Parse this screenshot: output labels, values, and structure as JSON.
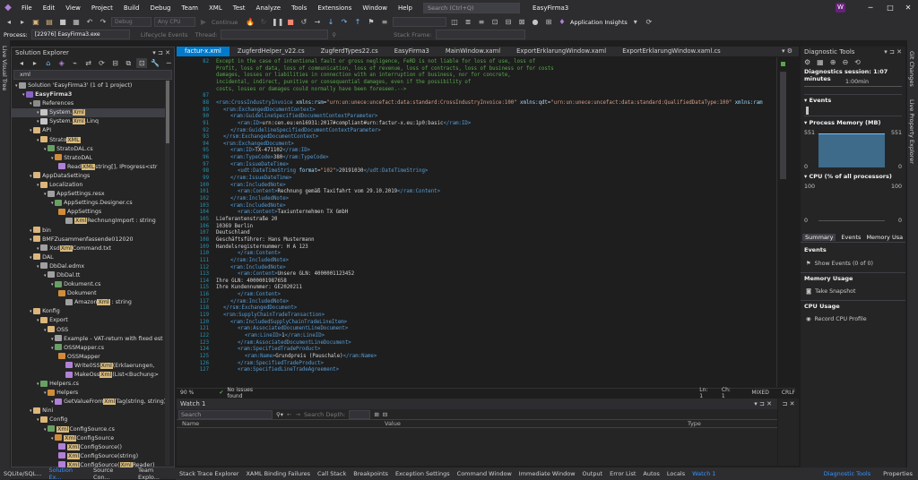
{
  "menubar": {
    "items": [
      "File",
      "Edit",
      "View",
      "Project",
      "Build",
      "Debug",
      "Team",
      "XML",
      "Test",
      "Analyze",
      "Tools",
      "Extensions",
      "Window",
      "Help"
    ],
    "search_placeholder": "Search (Ctrl+Q)",
    "title": "EasyFirma3",
    "avatar": "W"
  },
  "toolbar": {
    "config": "Debug",
    "platform": "Any CPU",
    "continue": "Continue",
    "insights": "Application Insights"
  },
  "process_bar": {
    "label": "Process:",
    "process": "[22976] EasyFirma3.exe",
    "lifecycle": "Lifecycle Events",
    "thread": "Thread:",
    "stack": "Stack Frame:"
  },
  "left_strip": {
    "label": "Live Visual Tree"
  },
  "solution_explorer": {
    "title": "Solution Explorer",
    "search_value": "xml",
    "nodes": [
      {
        "d": 0,
        "t": "Solution 'EasyFirma3' (1 of 1 project)",
        "c": "#9b9b9b"
      },
      {
        "d": 1,
        "t": "EasyFirma3",
        "c": "#8a62c4",
        "b": true
      },
      {
        "d": 2,
        "t": "References",
        "c": "#8a8a8a"
      },
      {
        "d": 3,
        "p": "System.",
        "h": "Xml",
        "s": "",
        "c": "#c5c5c5",
        "sel": true
      },
      {
        "d": 3,
        "p": "System.",
        "h": "Xml",
        "s": ".Linq",
        "c": "#c5c5c5"
      },
      {
        "d": 2,
        "t": "API",
        "c": "#dcb67a"
      },
      {
        "d": 3,
        "p": "Strato",
        "h": "XML",
        "s": "",
        "c": "#dcb67a"
      },
      {
        "d": 4,
        "t": "StratoDAL.cs",
        "c": "#68a063"
      },
      {
        "d": 5,
        "t": "StratoDAL",
        "c": "#d18c3a"
      },
      {
        "d": 6,
        "p": "Read",
        "h": "XML",
        "s": "string[], IProgress<str",
        "c": "#b180d7"
      },
      {
        "d": 2,
        "t": "AppDataSettings",
        "c": "#dcb67a"
      },
      {
        "d": 3,
        "t": "Localization",
        "c": "#dcb67a"
      },
      {
        "d": 4,
        "t": "AppSettings.resx",
        "c": "#a0a0a0"
      },
      {
        "d": 5,
        "t": "AppSettings.Designer.cs",
        "c": "#68a063"
      },
      {
        "d": 6,
        "t": "AppSettings",
        "c": "#d18c3a"
      },
      {
        "d": 7,
        "p": "",
        "h": "Xml",
        "s": "RechnungImport : string",
        "c": "#a0a0a0"
      },
      {
        "d": 2,
        "t": "bin",
        "c": "#dcb67a"
      },
      {
        "d": 2,
        "t": "BMFZusammenfassende012020",
        "c": "#dcb67a"
      },
      {
        "d": 3,
        "p": "Xsd",
        "h": "Xml",
        "s": "Command.txt",
        "c": "#a0a0a0"
      },
      {
        "d": 2,
        "t": "DAL",
        "c": "#dcb67a"
      },
      {
        "d": 3,
        "t": "DbDal.edmx",
        "c": "#a0a0a0"
      },
      {
        "d": 4,
        "t": "DbDal.tt",
        "c": "#a0a0a0"
      },
      {
        "d": 5,
        "t": "Dokument.cs",
        "c": "#68a063"
      },
      {
        "d": 6,
        "t": "Dokument",
        "c": "#d18c3a"
      },
      {
        "d": 7,
        "p": "Amazon",
        "h": "Xml",
        "s": " : string",
        "c": "#a0a0a0"
      },
      {
        "d": 2,
        "t": "Konfig",
        "c": "#dcb67a"
      },
      {
        "d": 3,
        "t": "Export",
        "c": "#dcb67a"
      },
      {
        "d": 4,
        "t": "OSS",
        "c": "#dcb67a"
      },
      {
        "d": 5,
        "t": "Example - VAT-return with fixed est",
        "c": "#a0a0a0"
      },
      {
        "d": 5,
        "t": "OSSMapper.cs",
        "c": "#68a063"
      },
      {
        "d": 6,
        "t": "OSSMapper",
        "c": "#d18c3a"
      },
      {
        "d": 7,
        "p": "Write0SS",
        "h": "Xml",
        "s": "(Erklaerungen,",
        "c": "#b180d7"
      },
      {
        "d": 7,
        "p": "MakeOss",
        "h": "Xml",
        "s": "(List<Buchung>",
        "c": "#b180d7"
      },
      {
        "d": 3,
        "t": "Helpers.cs",
        "c": "#68a063"
      },
      {
        "d": 4,
        "t": "Helpers",
        "c": "#d18c3a"
      },
      {
        "d": 5,
        "p": "GetValueFrom",
        "h": "Xml",
        "s": "Tag(string, string)",
        "c": "#b180d7"
      },
      {
        "d": 2,
        "t": "Nini",
        "c": "#dcb67a"
      },
      {
        "d": 3,
        "t": "Config",
        "c": "#dcb67a"
      },
      {
        "d": 4,
        "p": "",
        "h": "Xml",
        "s": "ConfigSource.cs",
        "c": "#68a063"
      },
      {
        "d": 5,
        "p": "",
        "h": "Xml",
        "s": "ConfigSource",
        "c": "#d18c3a"
      },
      {
        "d": 6,
        "p": "",
        "h": "Xml",
        "s": "ConfigSource()",
        "c": "#b180d7"
      },
      {
        "d": 6,
        "p": "",
        "h": "Xml",
        "s": "ConfigSource(string)",
        "c": "#b180d7"
      },
      {
        "d": 6,
        "p": "",
        "h": "Xml",
        "s": "ConfigSource(",
        "h2": "Xml",
        "s2": "Reader)",
        "c": "#b180d7"
      },
      {
        "d": 2,
        "t": "obj",
        "c": "#dcb67a"
      }
    ]
  },
  "bottom_left_tabs": [
    "SQLite/SQL...",
    "Solution Ex...",
    "Source Con...",
    "Team Explo..."
  ],
  "doc_tabs": [
    "factur-x.xml",
    "ZugferdHelper_v22.cs",
    "ZugferdTypes22.cs",
    "EasyFirma3",
    "MainWindow.xaml",
    "ExportErklarungWindow.xaml",
    "ExportErklarungWindow.xaml.cs"
  ],
  "code_lines": [
    {
      "n": "82",
      "i": 0,
      "parts": [
        [
          "cmt",
          "Except in the case of intentional fault or gross negligence, FeRD is not liable for loss of use, loss of"
        ]
      ]
    },
    {
      "n": "",
      "i": 0,
      "parts": [
        [
          "cmt",
          "Profit, loss of data, loss of communication, loss of revenue, loss of contracts, loss of business or for costs"
        ]
      ]
    },
    {
      "n": "",
      "i": 0,
      "parts": [
        [
          "cmt",
          "damages, losses or liabilities in connection with an interruption of business, nor for concrete,"
        ]
      ]
    },
    {
      "n": "",
      "i": 0,
      "parts": [
        [
          "cmt",
          "incidental, indirect, punitive or consequential damages, even if the possibility of"
        ]
      ]
    },
    {
      "n": "",
      "i": 0,
      "parts": [
        [
          "cmt",
          "costs, losses or damages could normally have been foreseen.-->"
        ]
      ]
    },
    {
      "n": "87",
      "i": 0,
      "parts": []
    },
    {
      "n": "88",
      "i": 0,
      "parts": [
        [
          "tag",
          "<rsm:CrossIndustryInvoice "
        ],
        [
          "att",
          "xmlns:rsm"
        ],
        [
          "",
          "="
        ],
        [
          "str",
          "\"urn:un:unece:uncefact:data:standard:CrossIndustryInvoice:100\""
        ],
        [
          "att",
          " xmlns:qdt"
        ],
        [
          "",
          "="
        ],
        [
          "str",
          "\"urn:un:unece:uncefact:data:standard:QualifiedDataType:100\""
        ],
        [
          "att",
          " xmlns:ram"
        ]
      ]
    },
    {
      "n": "89",
      "i": 1,
      "parts": [
        [
          "tag",
          "<rsm:ExchangedDocumentContext>"
        ]
      ]
    },
    {
      "n": "90",
      "i": 2,
      "parts": [
        [
          "tag",
          "<ram:GuidelineSpecifiedDocumentContextParameter>"
        ]
      ]
    },
    {
      "n": "91",
      "i": 3,
      "parts": [
        [
          "tag",
          "<ram:ID>"
        ],
        [
          "",
          "urn:cen.eu:en16931:2017#compliant#urn:factur-x.eu:1p0:basic"
        ],
        [
          "tag",
          "</ram:ID>"
        ]
      ]
    },
    {
      "n": "92",
      "i": 2,
      "parts": [
        [
          "tag",
          "</ram:GuidelineSpecifiedDocumentContextParameter>"
        ]
      ]
    },
    {
      "n": "93",
      "i": 1,
      "parts": [
        [
          "tag",
          "</rsm:ExchangedDocumentContext>"
        ]
      ]
    },
    {
      "n": "94",
      "i": 1,
      "parts": [
        [
          "tag",
          "<rsm:ExchangedDocument>"
        ]
      ]
    },
    {
      "n": "95",
      "i": 2,
      "parts": [
        [
          "tag",
          "<ram:ID>"
        ],
        [
          "",
          "TX-471102"
        ],
        [
          "tag",
          "</ram:ID>"
        ]
      ]
    },
    {
      "n": "96",
      "i": 2,
      "parts": [
        [
          "tag",
          "<ram:TypeCode>"
        ],
        [
          "",
          "380"
        ],
        [
          "tag",
          "</ram:TypeCode>"
        ]
      ]
    },
    {
      "n": "97",
      "i": 2,
      "parts": [
        [
          "tag",
          "<ram:IssueDateTime>"
        ]
      ]
    },
    {
      "n": "98",
      "i": 3,
      "parts": [
        [
          "tag",
          "<udt:DateTimeString "
        ],
        [
          "att",
          "format"
        ],
        [
          "",
          "="
        ],
        [
          "str",
          "\"102\""
        ],
        [
          "tag",
          ">"
        ],
        [
          "",
          "20191030"
        ],
        [
          "tag",
          "</udt:DateTimeString>"
        ]
      ]
    },
    {
      "n": "99",
      "i": 2,
      "parts": [
        [
          "tag",
          "</ram:IssueDateTime>"
        ]
      ]
    },
    {
      "n": "100",
      "i": 2,
      "parts": [
        [
          "tag",
          "<ram:IncludedNote>"
        ]
      ]
    },
    {
      "n": "101",
      "i": 3,
      "parts": [
        [
          "tag",
          "<ram:Content>"
        ],
        [
          "",
          "Rechnung gemäß Taxifahrt vom 29.10.2019"
        ],
        [
          "tag",
          "</ram:Content>"
        ]
      ]
    },
    {
      "n": "102",
      "i": 2,
      "parts": [
        [
          "tag",
          "</ram:IncludedNote>"
        ]
      ]
    },
    {
      "n": "103",
      "i": 2,
      "parts": [
        [
          "tag",
          "<ram:IncludedNote>"
        ]
      ]
    },
    {
      "n": "104",
      "i": 3,
      "parts": [
        [
          "tag",
          "<ram:Content>"
        ],
        [
          "",
          "Taxiunternehmen TX GmbH"
        ]
      ]
    },
    {
      "n": "105",
      "i": 0,
      "parts": [
        [
          "",
          "Lieferantenstraße 20"
        ]
      ]
    },
    {
      "n": "106",
      "i": 0,
      "parts": [
        [
          "",
          "10369 Berlin"
        ]
      ]
    },
    {
      "n": "107",
      "i": 0,
      "parts": [
        [
          "",
          "Deutschland"
        ]
      ]
    },
    {
      "n": "108",
      "i": 0,
      "parts": [
        [
          "",
          "Geschäftsführer: Hans Mustermann"
        ]
      ]
    },
    {
      "n": "109",
      "i": 0,
      "parts": [
        [
          "",
          "Handelsregisternummer: H A 123"
        ]
      ]
    },
    {
      "n": "110",
      "i": 3,
      "parts": [
        [
          "tag",
          "</ram:Content>"
        ]
      ]
    },
    {
      "n": "111",
      "i": 2,
      "parts": [
        [
          "tag",
          "</ram:IncludedNote>"
        ]
      ]
    },
    {
      "n": "112",
      "i": 2,
      "parts": [
        [
          "tag",
          "<ram:IncludedNote>"
        ]
      ]
    },
    {
      "n": "113",
      "i": 3,
      "parts": [
        [
          "tag",
          "<ram:Content>"
        ],
        [
          "",
          "Unsere GLN: 4000001123452"
        ]
      ]
    },
    {
      "n": "114",
      "i": 0,
      "parts": [
        [
          "",
          "Ihre GLN: 4000001987658"
        ]
      ]
    },
    {
      "n": "115",
      "i": 0,
      "parts": [
        [
          "",
          "Ihre Kundennummer: GE2020211"
        ]
      ]
    },
    {
      "n": "116",
      "i": 3,
      "parts": [
        [
          "tag",
          "</ram:Content>"
        ]
      ]
    },
    {
      "n": "117",
      "i": 2,
      "parts": [
        [
          "tag",
          "</ram:IncludedNote>"
        ]
      ]
    },
    {
      "n": "118",
      "i": 1,
      "parts": [
        [
          "tag",
          "</rsm:ExchangedDocument>"
        ]
      ]
    },
    {
      "n": "119",
      "i": 1,
      "parts": [
        [
          "tag",
          "<rsm:SupplyChainTradeTransaction>"
        ]
      ]
    },
    {
      "n": "120",
      "i": 2,
      "parts": [
        [
          "tag",
          "<ram:IncludedSupplyChainTradeLineItem>"
        ]
      ]
    },
    {
      "n": "121",
      "i": 3,
      "parts": [
        [
          "tag",
          "<ram:AssociatedDocumentLineDocument>"
        ]
      ]
    },
    {
      "n": "122",
      "i": 4,
      "parts": [
        [
          "tag",
          "<ram:LineID>"
        ],
        [
          "",
          "1"
        ],
        [
          "tag",
          "</ram:LineID>"
        ]
      ]
    },
    {
      "n": "123",
      "i": 3,
      "parts": [
        [
          "tag",
          "</ram:AssociatedDocumentLineDocument>"
        ]
      ]
    },
    {
      "n": "124",
      "i": 3,
      "parts": [
        [
          "tag",
          "<ram:SpecifiedTradeProduct>"
        ]
      ]
    },
    {
      "n": "125",
      "i": 4,
      "parts": [
        [
          "tag",
          "<ram:Name>"
        ],
        [
          "",
          "Grundpreis (Pauschale)"
        ],
        [
          "tag",
          "</ram:Name>"
        ]
      ]
    },
    {
      "n": "126",
      "i": 3,
      "parts": [
        [
          "tag",
          "</ram:SpecifiedTradeProduct>"
        ]
      ]
    },
    {
      "n": "127",
      "i": 3,
      "parts": [
        [
          "tag",
          "<ram:SpecifiedLineTradeAgreement>"
        ]
      ]
    }
  ],
  "editor_status": {
    "zoom": "90 %",
    "issues": "No issues found",
    "line": "Ln: 1",
    "col": "Ch: 1",
    "mode": "MIXED",
    "eol": "CRLF"
  },
  "watch": {
    "title": "Watch 1",
    "search_placeholder": "Search",
    "search_depth": "Search Depth:",
    "columns": [
      "Name",
      "Value",
      "Type"
    ]
  },
  "diagnostics": {
    "title": "Diagnostic Tools",
    "session": "Diagnostics session: 1:07 minutes",
    "timeline": "1:00min",
    "events_header": "Events",
    "memory_header": "Process Memory (MB)",
    "mem_max": "551",
    "mem_min": "0",
    "cpu_header": "CPU (% of all processors)",
    "cpu_max": "100",
    "cpu_min": "0",
    "tabs": [
      "Summary",
      "Events",
      "Memory Usa"
    ],
    "events_section": "Events",
    "show_events": "Show Events (0 of 0)",
    "memory_section": "Memory Usage",
    "snapshot": "Take Snapshot",
    "cpu_section": "CPU Usage",
    "record": "Record CPU Profile"
  },
  "right_strip": [
    "Git Changes",
    "Live Property Explorer"
  ],
  "bottom_tabs": [
    "Stack Trace Explorer",
    "XAML Binding Failures",
    "Call Stack",
    "Breakpoints",
    "Exception Settings",
    "Command Window",
    "Immediate Window",
    "Output",
    "Error List",
    "Autos",
    "Locals",
    "Watch 1"
  ],
  "right_bottom_tabs": [
    "Diagnostic Tools",
    "Properties"
  ],
  "colors": {
    "accent": "#007acc",
    "highlight": "#d7ba7d",
    "memory_fill": "#3e6b8a"
  }
}
